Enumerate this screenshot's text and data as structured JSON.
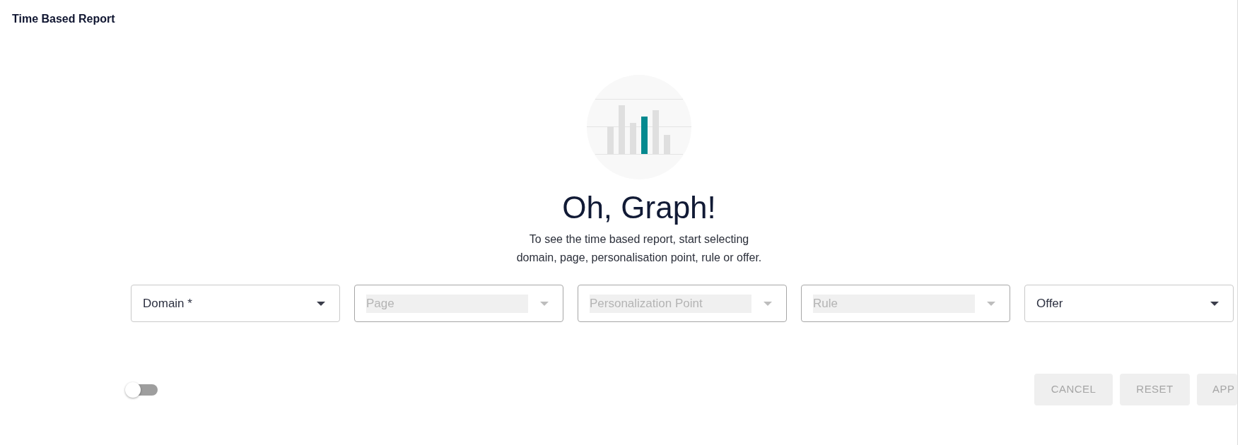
{
  "page": {
    "title": "Time Based Report"
  },
  "empty_state": {
    "heading": "Oh, Graph!",
    "message_lines": [
      "To see the time based report, start selecting",
      "domain, page, personalisation point, rule or offer."
    ]
  },
  "filters": [
    {
      "label": "Domain *",
      "disabled": false
    },
    {
      "label": "Page",
      "disabled": true
    },
    {
      "label": "Personalization Point",
      "disabled": true
    },
    {
      "label": "Rule",
      "disabled": true
    },
    {
      "label": "Offer",
      "disabled": false
    }
  ],
  "toggle": {
    "on": false
  },
  "buttons": [
    {
      "label": "CANCEL",
      "disabled": true
    },
    {
      "label": "RESET",
      "disabled": true
    },
    {
      "label": "APP",
      "disabled": true
    }
  ]
}
